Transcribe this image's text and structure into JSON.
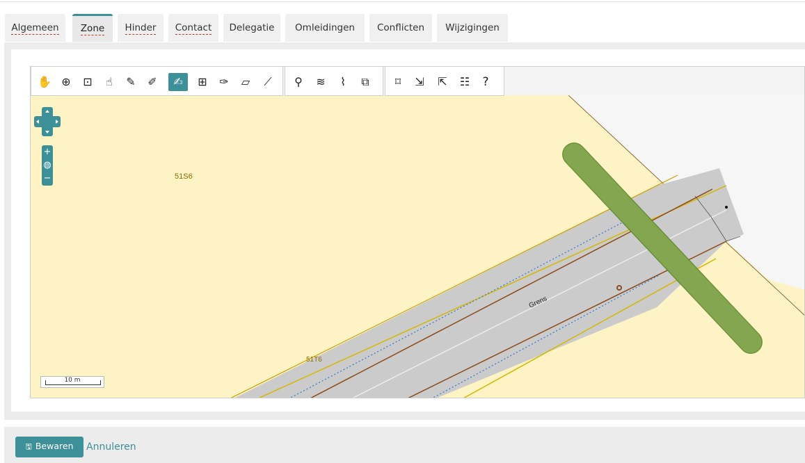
{
  "tabs": [
    {
      "label": "Algemeen"
    },
    {
      "label": "Zone"
    },
    {
      "label": "Hinder"
    },
    {
      "label": "Contact"
    },
    {
      "label": "Delegatie"
    },
    {
      "label": "Omleidingen"
    },
    {
      "label": "Conflicten"
    },
    {
      "label": "Wijzigingen"
    }
  ],
  "active_tab": "Zone",
  "toolbar": {
    "icons": [
      "pan-icon",
      "zoom-box-icon",
      "zoom-select-icon",
      "select-feature-icon",
      "draw-line-icon",
      "edit-vertex-icon",
      "draw-polygon-icon",
      "add-point-icon",
      "modify-feature-icon",
      "eraser-icon",
      "measure-icon",
      "search-map-icon",
      "layers-icon",
      "attach-icon",
      "copy-feature-icon",
      "full-extent-icon",
      "import-icon",
      "export-icon",
      "legend-icon",
      "help-icon"
    ],
    "help_label": "?"
  },
  "map": {
    "labels": {
      "parcel_a": "51S6",
      "parcel_b": "51T6",
      "road": "Grens"
    },
    "scale_label": "10 m",
    "zoom_in": "+",
    "zoom_out": "−"
  },
  "colors": {
    "accent": "#3d8f98",
    "parcel_fill": "#fdf3c4",
    "road_gray": "#cbcbcb",
    "zone_green": "#8aaa55"
  },
  "footer": {
    "save_label": "Bewaren",
    "cancel_label": "Annuleren"
  }
}
